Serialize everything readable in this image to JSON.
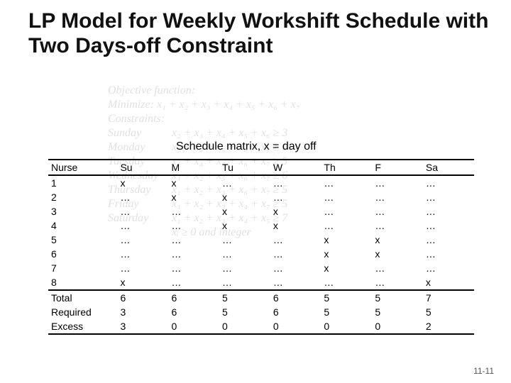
{
  "title": "LP Model for Weekly Workshift Schedule with Two Days-off Constraint",
  "ghost": {
    "heading": "Objective function:",
    "minimize": "Minimize: x₁ + x₂ + x₃ + x₄ + x₅ + x₆ + x₇",
    "constraints_label": "Constraints:",
    "rows": [
      [
        "Sunday",
        "x₂ + x₃ + x₄ + x₅ + x₆   ≥ 3"
      ],
      [
        "Monday",
        "x₃ + x₄ + x₅ + x₆ + x₇   ≥ 6"
      ],
      [
        "Tuesday",
        "x₁ + x₄ + x₅ + x₆ + x₇   ≥ 5"
      ],
      [
        "Wednesday",
        "x₁ + x₂ + x₅ + x₆ + x₇   ≥ 6"
      ],
      [
        "Thursday",
        "x₁ + x₂ + x₃ + x₆ + x₇   ≥ 5"
      ],
      [
        "Friday",
        "x₁ + x₂ + x₃ + x₄ + x₇   ≥ 5"
      ],
      [
        "Saturday",
        "x₁ + x₂ + x₃ + x₄ + x₅   ≥ 7"
      ],
      [
        "",
        "xᵢ ≥ 0 and integer"
      ]
    ]
  },
  "caption": "Schedule matrix, x = day off",
  "table": {
    "headers": [
      "Nurse",
      "Su",
      "M",
      "Tu",
      "W",
      "Th",
      "F",
      "Sa"
    ],
    "rows": [
      [
        "1",
        "x",
        "x",
        "…",
        "…",
        "…",
        "…",
        "…"
      ],
      [
        "2",
        "…",
        "x",
        "x",
        "…",
        "…",
        "…",
        "…"
      ],
      [
        "3",
        "…",
        "…",
        "x",
        "x",
        "…",
        "…",
        "…"
      ],
      [
        "4",
        "…",
        "…",
        "x",
        "x",
        "…",
        "…",
        "…"
      ],
      [
        "5",
        "…",
        "…",
        "…",
        "…",
        "x",
        "x",
        "…"
      ],
      [
        "6",
        "…",
        "…",
        "…",
        "…",
        "x",
        "x",
        "…"
      ],
      [
        "7",
        "…",
        "…",
        "…",
        "…",
        "x",
        "…",
        "…"
      ],
      [
        "8",
        "x",
        "…",
        "…",
        "…",
        "…",
        "…",
        "x"
      ]
    ],
    "summary": [
      [
        "Total",
        "6",
        "6",
        "5",
        "6",
        "5",
        "5",
        "7"
      ],
      [
        "Required",
        "3",
        "6",
        "5",
        "6",
        "5",
        "5",
        "5"
      ],
      [
        "Excess",
        "3",
        "0",
        "0",
        "0",
        "0",
        "0",
        "2"
      ]
    ]
  },
  "page_number": "11-11",
  "chart_data": {
    "type": "table",
    "title": "Schedule matrix, x = day off",
    "columns": [
      "Nurse",
      "Su",
      "M",
      "Tu",
      "W",
      "Th",
      "F",
      "Sa"
    ],
    "rows": [
      {
        "Nurse": "1",
        "Su": "x",
        "M": "x",
        "Tu": "…",
        "W": "…",
        "Th": "…",
        "F": "…",
        "Sa": "…"
      },
      {
        "Nurse": "2",
        "Su": "…",
        "M": "x",
        "Tu": "x",
        "W": "…",
        "Th": "…",
        "F": "…",
        "Sa": "…"
      },
      {
        "Nurse": "3",
        "Su": "…",
        "M": "…",
        "Tu": "x",
        "W": "x",
        "Th": "…",
        "F": "…",
        "Sa": "…"
      },
      {
        "Nurse": "4",
        "Su": "…",
        "M": "…",
        "Tu": "x",
        "W": "x",
        "Th": "…",
        "F": "…",
        "Sa": "…"
      },
      {
        "Nurse": "5",
        "Su": "…",
        "M": "…",
        "Tu": "…",
        "W": "…",
        "Th": "x",
        "F": "x",
        "Sa": "…"
      },
      {
        "Nurse": "6",
        "Su": "…",
        "M": "…",
        "Tu": "…",
        "W": "…",
        "Th": "x",
        "F": "x",
        "Sa": "…"
      },
      {
        "Nurse": "7",
        "Su": "…",
        "M": "…",
        "Tu": "…",
        "W": "…",
        "Th": "x",
        "F": "…",
        "Sa": "…"
      },
      {
        "Nurse": "8",
        "Su": "x",
        "M": "…",
        "Tu": "…",
        "W": "…",
        "Th": "…",
        "F": "…",
        "Sa": "x"
      },
      {
        "Nurse": "Total",
        "Su": 6,
        "M": 6,
        "Tu": 5,
        "W": 6,
        "Th": 5,
        "F": 5,
        "Sa": 7
      },
      {
        "Nurse": "Required",
        "Su": 3,
        "M": 6,
        "Tu": 5,
        "W": 6,
        "Th": 5,
        "F": 5,
        "Sa": 5
      },
      {
        "Nurse": "Excess",
        "Su": 3,
        "M": 0,
        "Tu": 0,
        "W": 0,
        "Th": 0,
        "F": 0,
        "Sa": 2
      }
    ]
  }
}
